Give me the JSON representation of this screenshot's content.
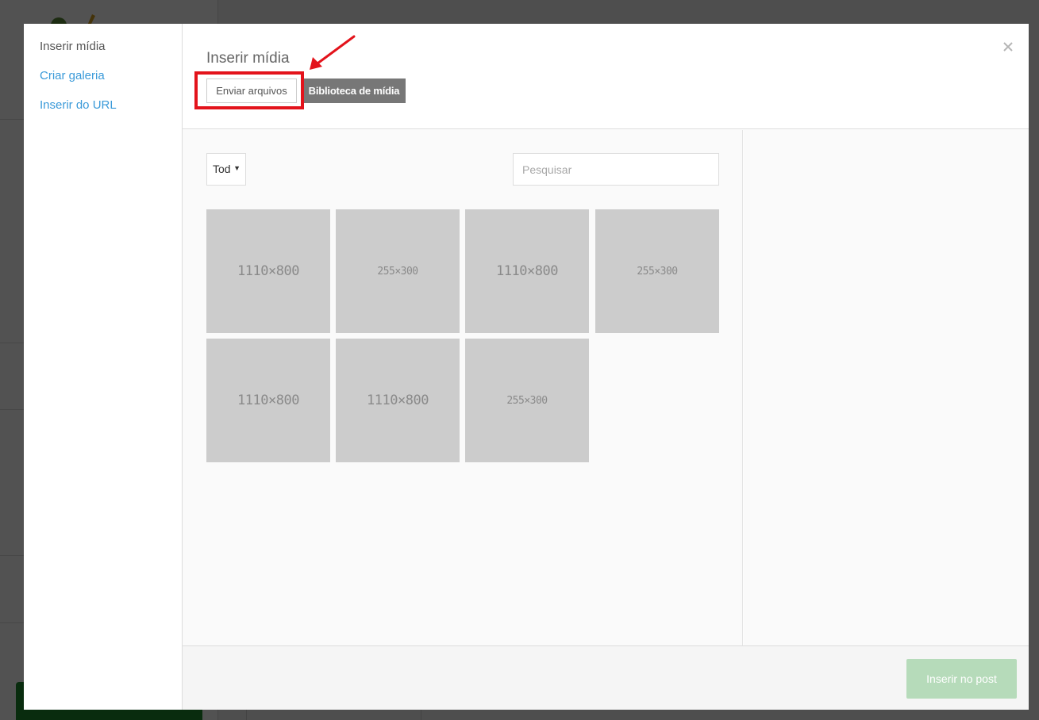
{
  "menu": {
    "items": [
      {
        "label": "Inserir mídia"
      },
      {
        "label": "Criar galeria"
      },
      {
        "label": "Inserir do URL"
      }
    ]
  },
  "header": {
    "title": "Inserir mídia",
    "close_icon": "close-icon"
  },
  "tabs": {
    "upload_label": "Enviar arquivos",
    "library_label": "Biblioteca de mídia"
  },
  "filter": {
    "selected": "Tod"
  },
  "search": {
    "placeholder": "Pesquisar",
    "value": ""
  },
  "thumbnails": [
    {
      "label": "1110×800"
    },
    {
      "label": "255×300"
    },
    {
      "label": "1110×800"
    },
    {
      "label": "255×300"
    },
    {
      "label": "1110×800"
    },
    {
      "label": "1110×800"
    },
    {
      "label": "255×300"
    }
  ],
  "toolbar": {
    "insert_label": "Inserir no post"
  },
  "colors": {
    "highlight": "#e3131b",
    "link": "#3a9ad9",
    "library_tab": "#777777",
    "insert_button": "#b6dbba"
  }
}
